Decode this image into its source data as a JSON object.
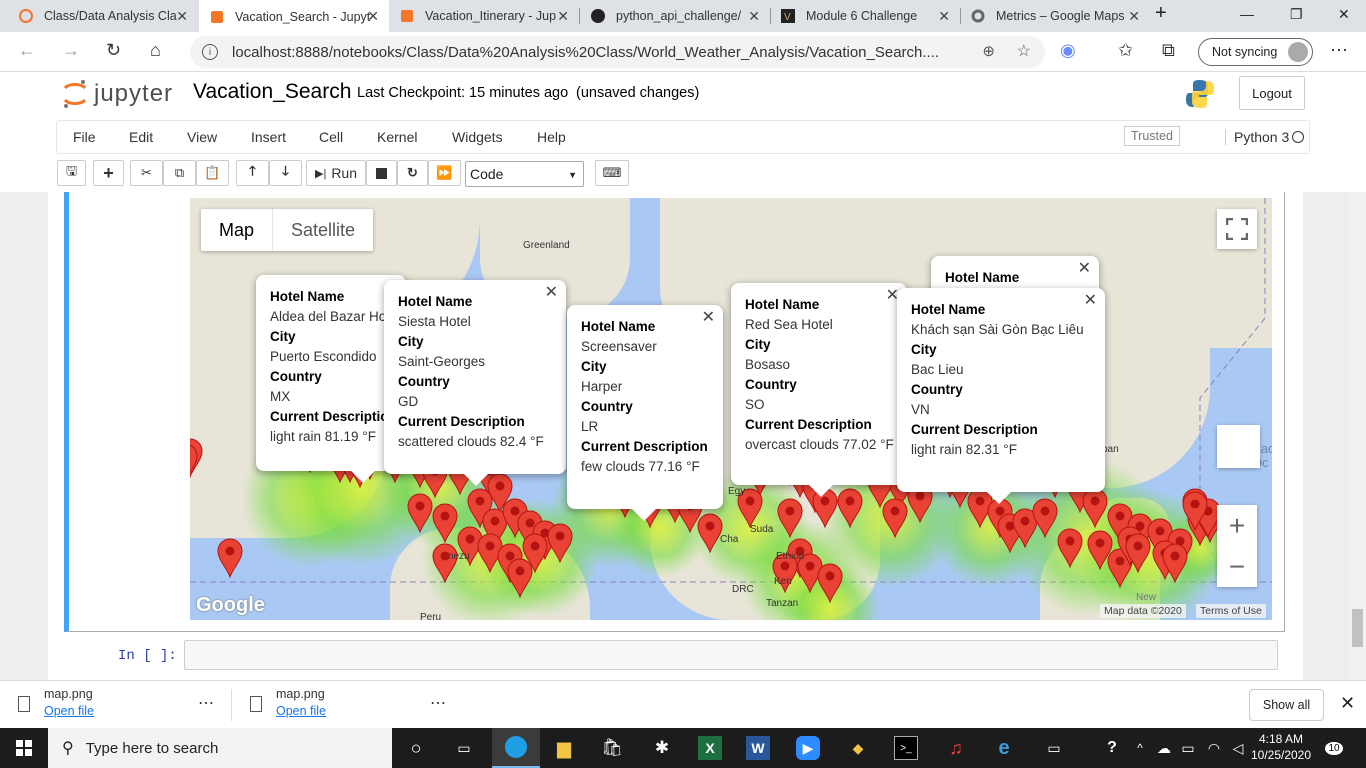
{
  "browser": {
    "tabs": [
      {
        "title": "Class/Data Analysis Cla",
        "active": false
      },
      {
        "title": "Vacation_Search - Jupyt",
        "active": true
      },
      {
        "title": "Vacation_Itinerary - Jup",
        "active": false
      },
      {
        "title": "python_api_challenge/",
        "active": false
      },
      {
        "title": "Module 6 Challenge",
        "active": false
      },
      {
        "title": "Metrics – Google Maps",
        "active": false
      }
    ],
    "url": "localhost:8888/notebooks/Class/Data%20Analysis%20Class/World_Weather_Analysis/Vacation_Search....",
    "sync_label": "Not syncing"
  },
  "jupyter": {
    "logo_text": "jupyter",
    "notebook_name": "Vacation_Search",
    "checkpoint": "Last Checkpoint: 15 minutes ago",
    "save_state": "(unsaved changes)",
    "logout_label": "Logout",
    "menu": [
      "File",
      "Edit",
      "View",
      "Insert",
      "Cell",
      "Kernel",
      "Widgets",
      "Help"
    ],
    "trusted_label": "Trusted",
    "kernel_name": "Python 3",
    "run_label": "Run",
    "cell_type": "Code",
    "input_prompt": "In [ ]:"
  },
  "map": {
    "map_type_labels": [
      "Map",
      "Satellite"
    ],
    "selected_map_type": "Map",
    "place_labels": [
      "Greenland",
      "Egy",
      "Suda",
      "Cha",
      "Ethiop",
      "Ken",
      "DRC",
      "Tanzan",
      "Peru",
      "nezu",
      "pan",
      "New"
    ],
    "ocean_label_lines": [
      "Pacific",
      "Oc"
    ],
    "attribution": "Map data ©2020",
    "terms_label": "Terms of Use",
    "google_logo": "Google",
    "info_windows": [
      {
        "hotel_name": "Aldea del Bazar Ho",
        "city": "Puerto Escondido",
        "country": "MX",
        "description": "light rain 81.19 °F"
      },
      {
        "hotel_name": "Siesta Hotel",
        "city": "Saint-Georges",
        "country": "GD",
        "description": "scattered clouds 82.4 °F"
      },
      {
        "hotel_name": "Screensaver",
        "city": "Harper",
        "country": "LR",
        "description": "few clouds 77.16 °F"
      },
      {
        "hotel_name": "Red Sea Hotel",
        "city": "Bosaso",
        "country": "SO",
        "description": "overcast clouds 77.02 °F"
      },
      {
        "hotel_name": "",
        "city": "",
        "country": "",
        "description": ""
      },
      {
        "hotel_name": "Khách sạn Sài Gòn Bạc Liêu",
        "city": "Bac Lieu",
        "country": "VN",
        "description": "light rain 82.31 °F"
      }
    ],
    "field_labels": {
      "hotel_name": "Hotel Name",
      "city": "City",
      "country": "Country",
      "description": "Current Description"
    },
    "marker_color": "#ea4335"
  },
  "downloads": {
    "items": [
      {
        "file": "map.png",
        "action": "Open file"
      },
      {
        "file": "map.png",
        "action": "Open file"
      }
    ],
    "show_all_label": "Show all"
  },
  "taskbar": {
    "search_placeholder": "Type here to search",
    "time": "4:18 AM",
    "date": "10/25/2020",
    "notification_count": "10"
  }
}
